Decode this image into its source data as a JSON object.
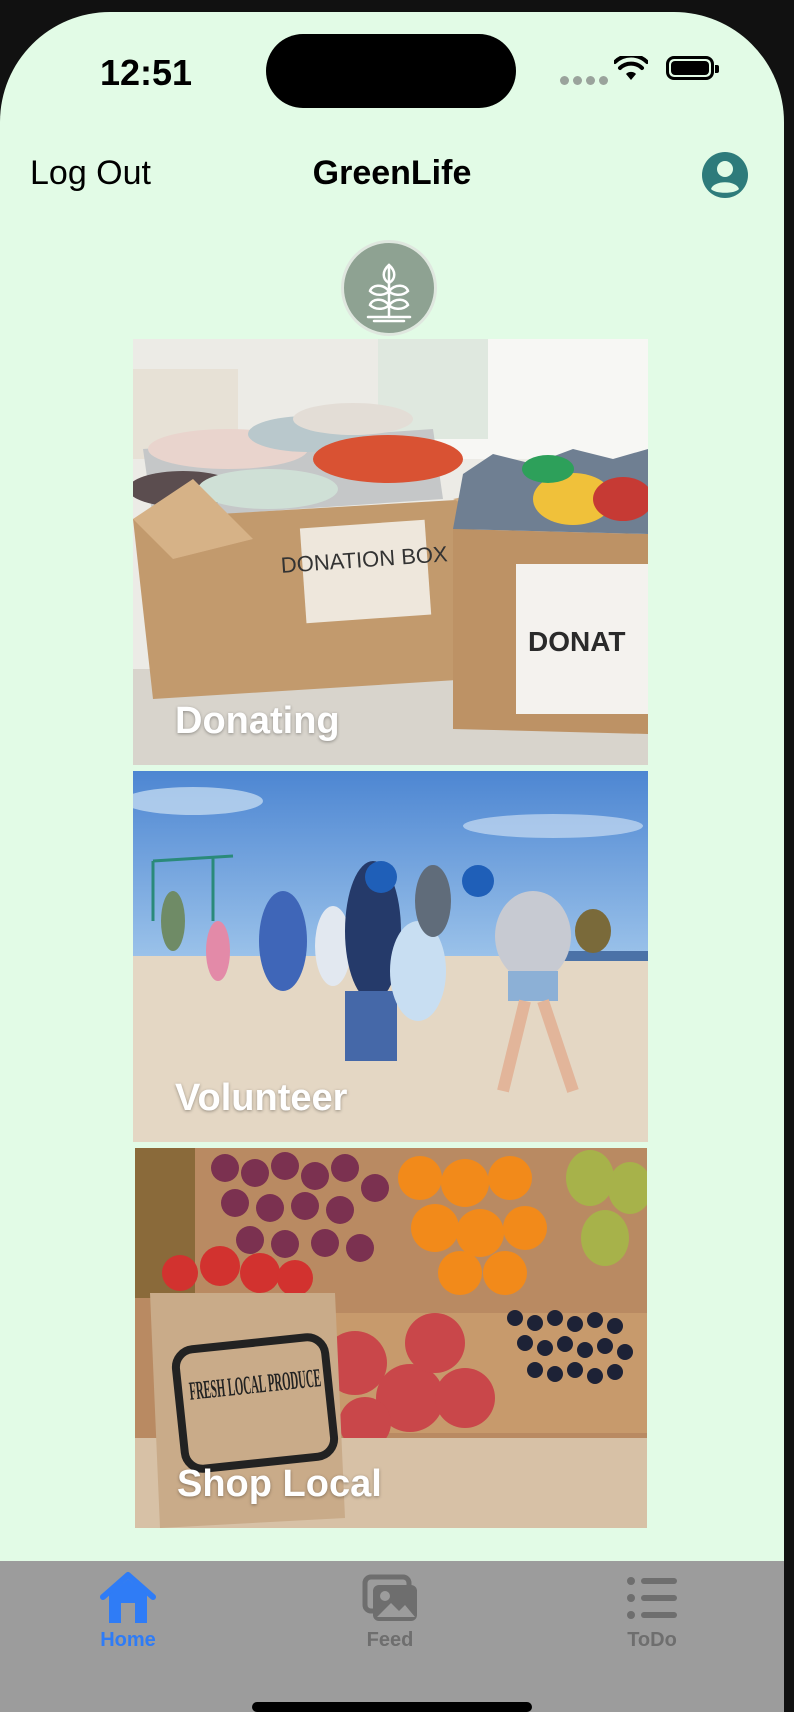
{
  "status_bar": {
    "time": "12:51"
  },
  "nav": {
    "logout_label": "Log Out",
    "title": "GreenLife",
    "profile_icon": "person-circle-icon"
  },
  "logo": {
    "icon": "plant-leaf-icon"
  },
  "cards": [
    {
      "label": "Donating",
      "image": "donation boxes with clothes"
    },
    {
      "label": "Volunteer",
      "image": "people cleaning a beach"
    },
    {
      "label": "Shop Local",
      "image": "fresh local produce market"
    }
  ],
  "image_text": {
    "donation_box": "DONATION BOX",
    "donat": "DONAT",
    "produce_bag": "FRESH LOCAL PRODUCE"
  },
  "tabs": [
    {
      "label": "Home",
      "icon": "house-icon",
      "active": true
    },
    {
      "label": "Feed",
      "icon": "photos-icon",
      "active": false
    },
    {
      "label": "ToDo",
      "icon": "list-icon",
      "active": false
    }
  ],
  "colors": {
    "background": "#e2fbe6",
    "tab_bar": "#9c9c9c",
    "active_tab": "#2f7cf6",
    "inactive_tab": "#6e6e6e",
    "profile": "#2e7b7b",
    "logo": "#8ea292"
  }
}
